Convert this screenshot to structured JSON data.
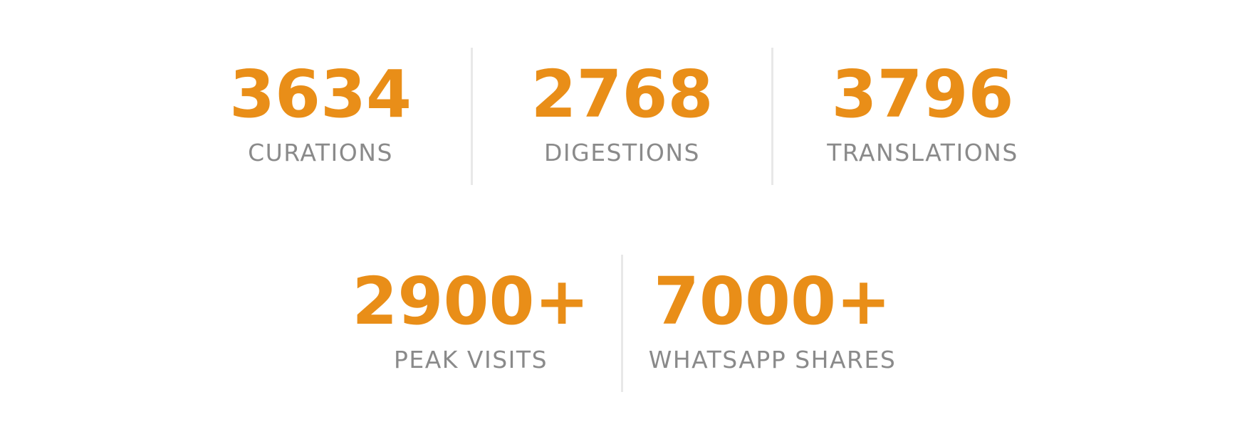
{
  "accent_color": "#e98e18",
  "label_color": "#8a8a8a",
  "divider_color": "#e8e8e8",
  "row1": [
    {
      "value": "3634",
      "label": "CURATIONS"
    },
    {
      "value": "2768",
      "label": "DIGESTIONS"
    },
    {
      "value": "3796",
      "label": "TRANSLATIONS"
    }
  ],
  "row2": [
    {
      "value": "2900+",
      "label": "PEAK VISITS"
    },
    {
      "value": "7000+",
      "label": "WHATSAPP SHARES"
    }
  ]
}
